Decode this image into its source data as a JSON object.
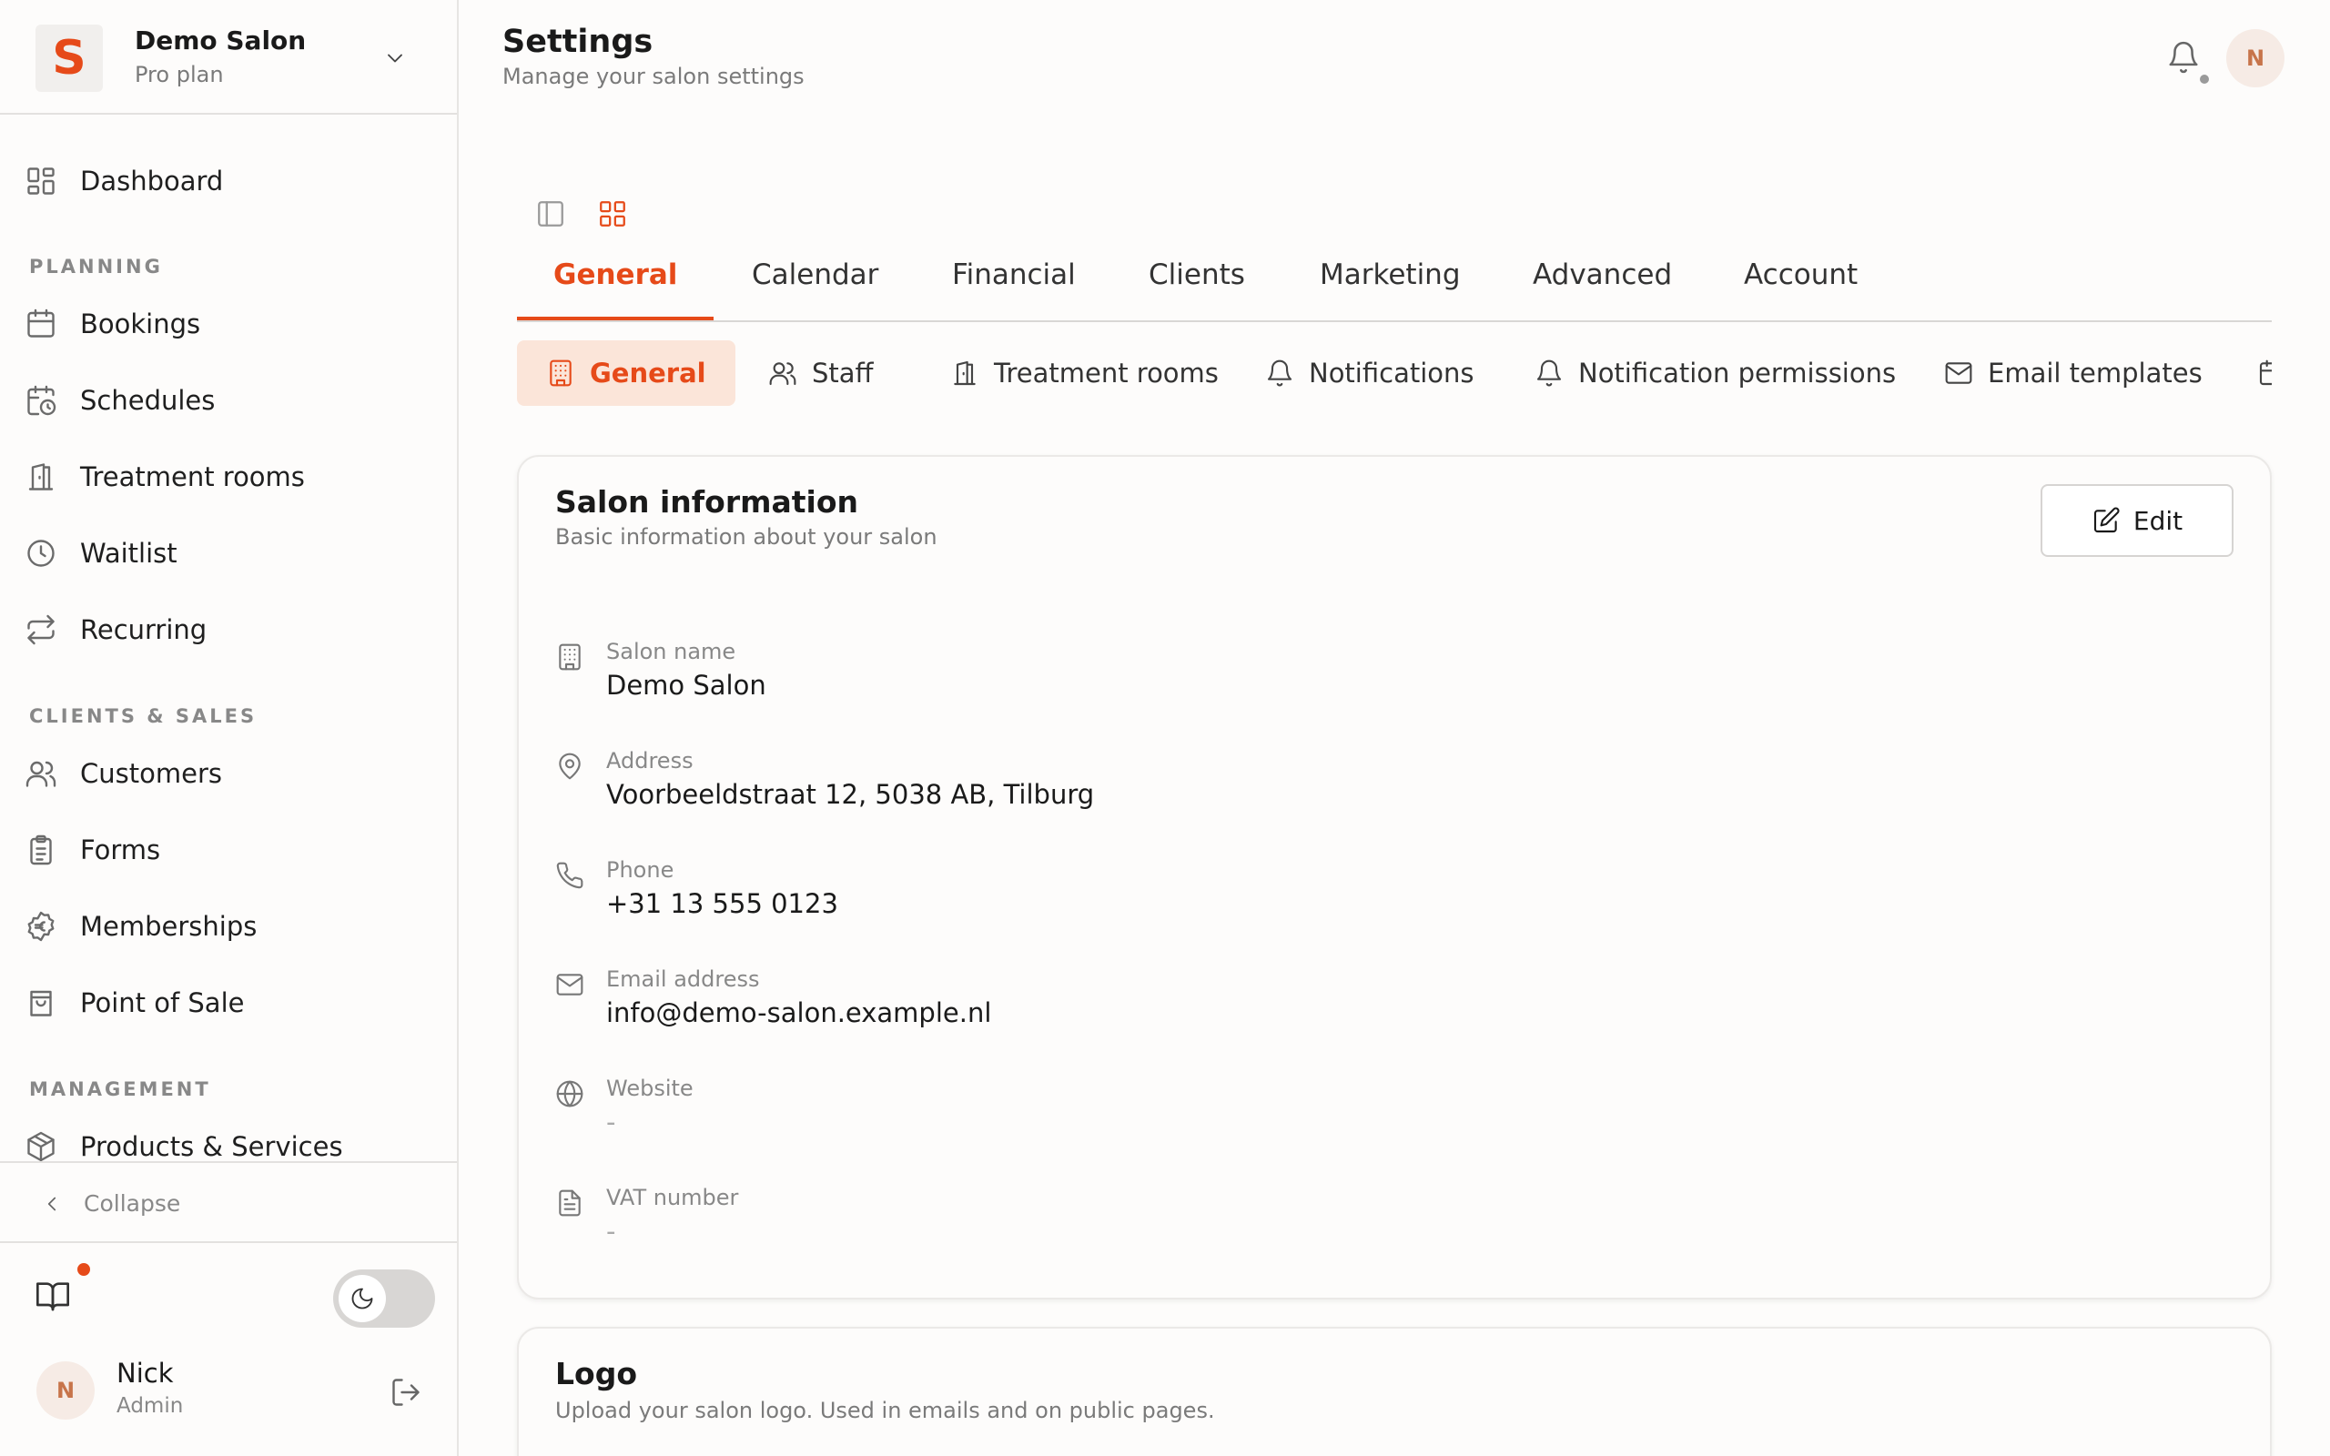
{
  "brand": {
    "initial": "S",
    "name": "Demo Salon",
    "plan": "Pro plan"
  },
  "nav": {
    "dashboard": "Dashboard",
    "section_planning": "PLANNING",
    "bookings": "Bookings",
    "schedules": "Schedules",
    "treatment_rooms": "Treatment rooms",
    "waitlist": "Waitlist",
    "recurring": "Recurring",
    "section_clients": "CLIENTS & SALES",
    "customers": "Customers",
    "forms": "Forms",
    "memberships": "Memberships",
    "point_of_sale": "Point of Sale",
    "section_management": "MANAGEMENT",
    "products_services": "Products & Services",
    "collapse": "Collapse"
  },
  "user": {
    "initial": "N",
    "name": "Nick",
    "role": "Admin"
  },
  "header": {
    "title": "Settings",
    "subtitle": "Manage your salon settings",
    "avatar_initial": "N"
  },
  "tabs": [
    "General",
    "Calendar",
    "Financial",
    "Clients",
    "Marketing",
    "Advanced",
    "Account"
  ],
  "subtabs": [
    "General",
    "Staff",
    "Treatment rooms",
    "Notifications",
    "Notification permissions",
    "Email templates"
  ],
  "salon_info": {
    "title": "Salon information",
    "subtitle": "Basic information about your salon",
    "edit_label": "Edit",
    "fields": [
      {
        "label": "Salon name",
        "value": "Demo Salon"
      },
      {
        "label": "Address",
        "value": "Voorbeeldstraat 12, 5038 AB, Tilburg"
      },
      {
        "label": "Phone",
        "value": "+31 13 555 0123"
      },
      {
        "label": "Email address",
        "value": "info@demo-salon.example.nl"
      },
      {
        "label": "Website",
        "value": "-"
      },
      {
        "label": "VAT number",
        "value": "-"
      }
    ]
  },
  "logo_card": {
    "title": "Logo",
    "subtitle": "Upload your salon logo. Used in emails and on public pages."
  },
  "colors": {
    "accent": "#e64a19",
    "accent_bg": "#fbe5d9",
    "avatar_bg": "#f6ebe5"
  }
}
